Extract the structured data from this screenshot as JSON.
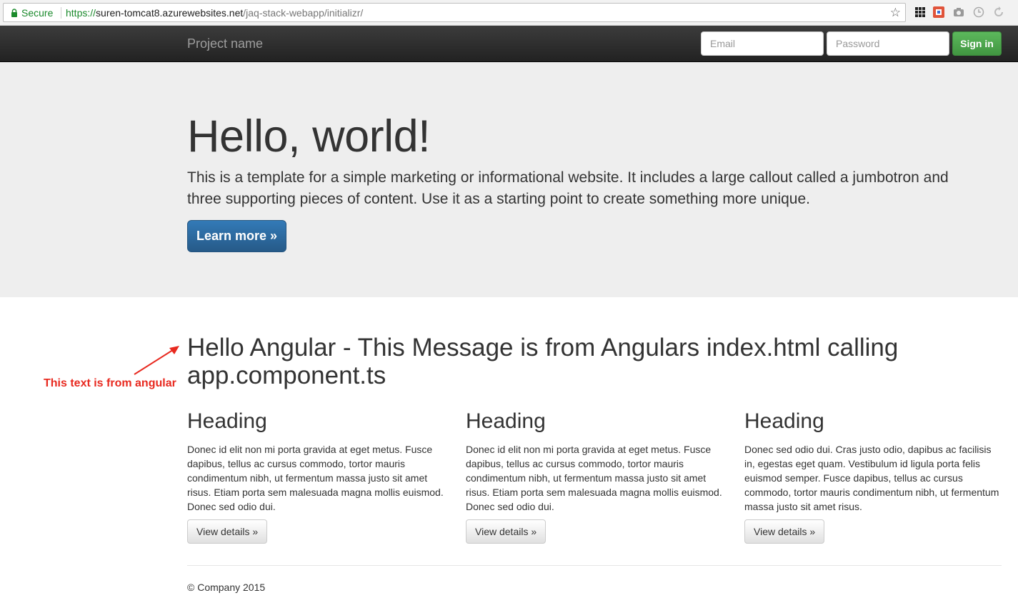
{
  "browser": {
    "secure_label": "Secure",
    "url_scheme": "https://",
    "url_host": "suren-tomcat8.azurewebsites.net",
    "url_path": "/jaq-stack-webapp/initializr/"
  },
  "navbar": {
    "brand": "Project name",
    "email_placeholder": "Email",
    "password_placeholder": "Password",
    "signin_label": "Sign in"
  },
  "jumbotron": {
    "title": "Hello, world!",
    "text": "This is a template for a simple marketing or informational website. It includes a large callout called a jumbotron and three supporting pieces of content. Use it as a starting point to create something more unique.",
    "button_label": "Learn more »"
  },
  "angular": {
    "heading": "Hello Angular - This Message is from Angulars index.html calling app.component.ts",
    "annotation": "This text is from angular"
  },
  "columns": [
    {
      "heading": "Heading",
      "text": "Donec id elit non mi porta gravida at eget metus. Fusce dapibus, tellus ac cursus commodo, tortor mauris condimentum nibh, ut fermentum massa justo sit amet risus. Etiam porta sem malesuada magna mollis euismod. Donec sed odio dui.",
      "button_label": "View details »"
    },
    {
      "heading": "Heading",
      "text": "Donec id elit non mi porta gravida at eget metus. Fusce dapibus, tellus ac cursus commodo, tortor mauris condimentum nibh, ut fermentum massa justo sit amet risus. Etiam porta sem malesuada magna mollis euismod. Donec sed odio dui.",
      "button_label": "View details »"
    },
    {
      "heading": "Heading",
      "text": "Donec sed odio dui. Cras justo odio, dapibus ac facilisis in, egestas eget quam. Vestibulum id ligula porta felis euismod semper. Fusce dapibus, tellus ac cursus commodo, tortor mauris condimentum nibh, ut fermentum massa justo sit amet risus.",
      "button_label": "View details »"
    }
  ],
  "footer": {
    "text": "© Company 2015"
  },
  "colors": {
    "secure_green": "#1b8a2c",
    "navbar_bg": "#222222",
    "jumbotron_bg": "#eeeeee",
    "primary_blue": "#337ab7",
    "success_green": "#5cb85c",
    "annotation_red": "#e8291f"
  },
  "icons": [
    "lock-icon",
    "bookmark-star-icon",
    "extension-grid-icon",
    "extension-red-icon",
    "camera-icon",
    "clock-icon",
    "refresh-icon",
    "annotation-arrow-icon"
  ]
}
